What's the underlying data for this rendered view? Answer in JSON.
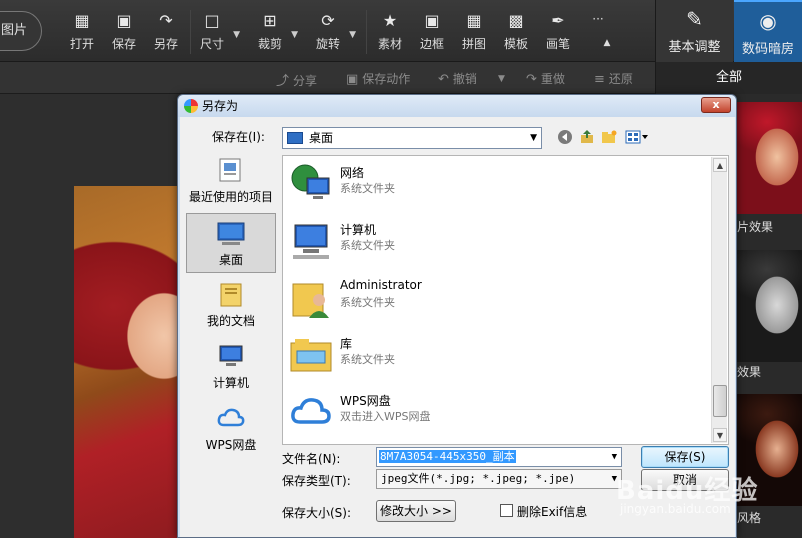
{
  "toolbar": {
    "pic_label": "图片",
    "items": [
      {
        "label": "打开",
        "icon": "open-icon"
      },
      {
        "label": "保存",
        "icon": "save-icon"
      },
      {
        "label": "另存",
        "icon": "save-as-icon"
      },
      {
        "label": "尺寸",
        "icon": "resize-icon"
      },
      {
        "label": "裁剪",
        "icon": "crop-icon"
      },
      {
        "label": "旋转",
        "icon": "rotate-icon"
      },
      {
        "label": "素材",
        "icon": "star-icon"
      },
      {
        "label": "边框",
        "icon": "frame-icon"
      },
      {
        "label": "拼图",
        "icon": "grid-icon"
      },
      {
        "label": "模板",
        "icon": "template-icon"
      },
      {
        "label": "画笔",
        "icon": "brush-icon"
      },
      {
        "label": "···",
        "icon": "more-icon"
      }
    ],
    "modes": [
      {
        "label": "基本调整",
        "icon": "edit-icon"
      },
      {
        "label": "数码暗房",
        "icon": "camera-icon"
      }
    ]
  },
  "subbar": {
    "share": "分享",
    "save_action": "保存动作",
    "undo": "撤销",
    "redo": "重做",
    "restore": "还原",
    "all_tab": "全部"
  },
  "effects": {
    "labels": [
      "片效果",
      "效果",
      "风格"
    ]
  },
  "dialog": {
    "title": "另存为",
    "close": "x",
    "save_in_label": "保存在(I):",
    "location": "桌面",
    "places": [
      {
        "label": "最近使用的项目",
        "icon": "recent-items-icon"
      },
      {
        "label": "桌面",
        "icon": "desktop-icon"
      },
      {
        "label": "我的文档",
        "icon": "documents-icon"
      },
      {
        "label": "计算机",
        "icon": "computer-icon"
      },
      {
        "label": "WPS网盘",
        "icon": "cloud-icon"
      }
    ],
    "files": [
      {
        "name": "网络",
        "desc": "系统文件夹",
        "icon": "network-icon"
      },
      {
        "name": "计算机",
        "desc": "系统文件夹",
        "icon": "computer-icon"
      },
      {
        "name": "Administrator",
        "desc": "系统文件夹",
        "icon": "user-folder-icon"
      },
      {
        "name": "库",
        "desc": "系统文件夹",
        "icon": "library-icon"
      },
      {
        "name": "WPS网盘",
        "desc": "双击进入WPS网盘",
        "icon": "cloud-icon"
      }
    ],
    "filename_label": "文件名(N):",
    "filename_value": "8M7A3054-445x350_副本",
    "filetype_label": "保存类型(T):",
    "filetype_value": "jpeg文件(*.jpg; *.jpeg; *.jpe)",
    "filesize_label": "保存大小(S):",
    "resize_button": "修改大小 >>",
    "exif_label": "删除Exif信息",
    "save_button": "保存(S)",
    "cancel_button": "取消"
  },
  "watermark": {
    "logo": "Baidu经验",
    "url": "jingyan.baidu.com"
  }
}
